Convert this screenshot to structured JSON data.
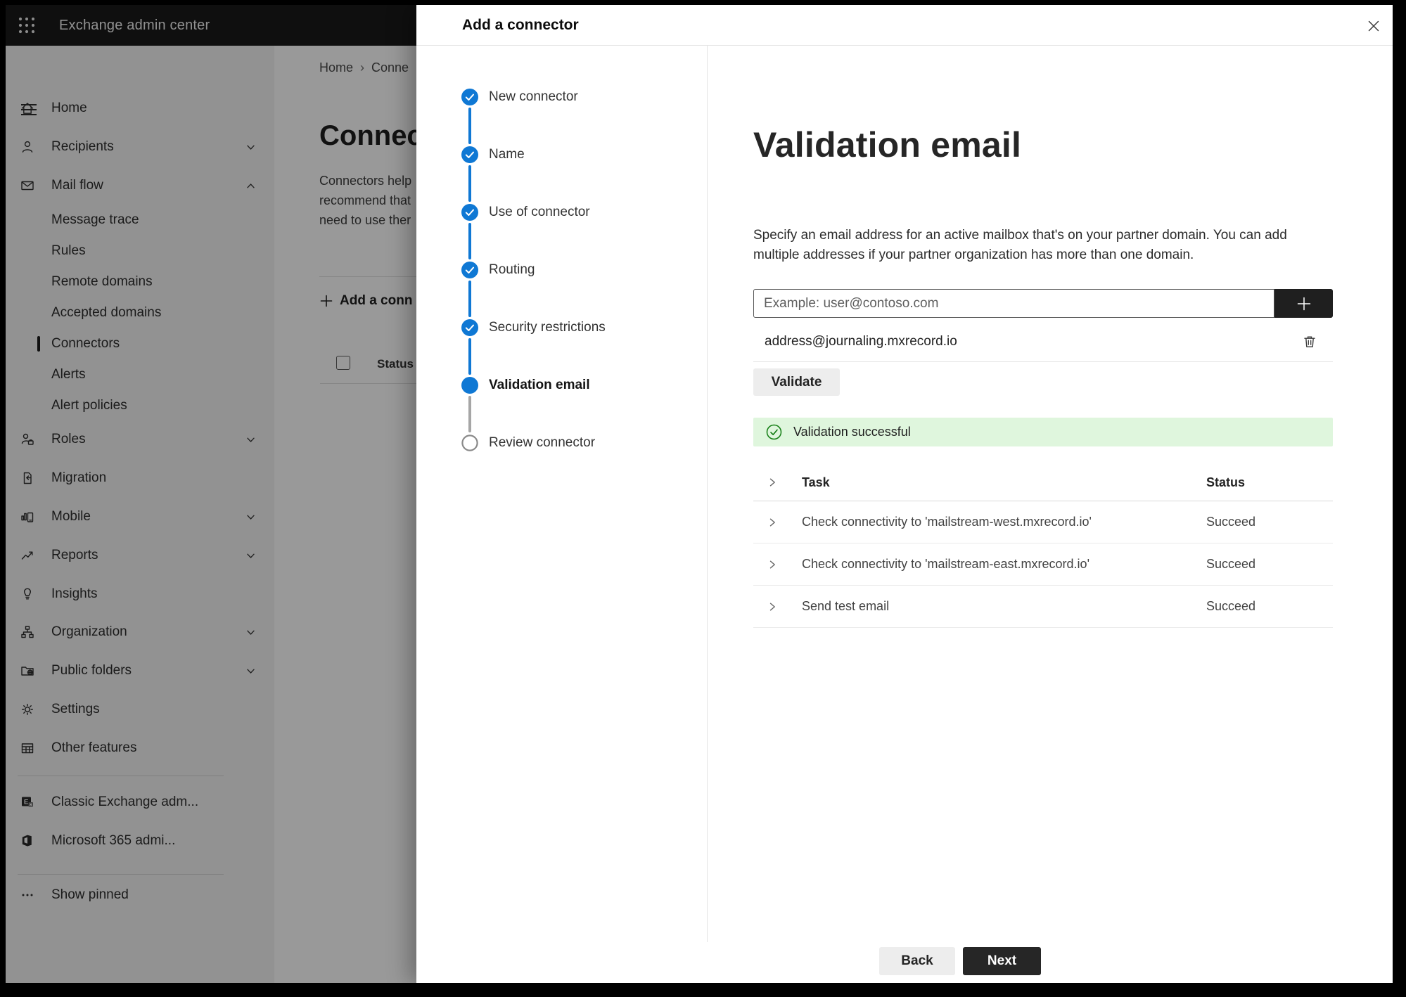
{
  "topbar": {
    "title": "Exchange admin center"
  },
  "sidebar": {
    "items": [
      {
        "type": "main",
        "label": "Home",
        "icon": "home-icon"
      },
      {
        "type": "main",
        "label": "Recipients",
        "icon": "person-icon",
        "chevron": "down"
      },
      {
        "type": "main",
        "label": "Mail flow",
        "icon": "mail-icon",
        "chevron": "up"
      },
      {
        "type": "sub",
        "label": "Message trace"
      },
      {
        "type": "sub",
        "label": "Rules"
      },
      {
        "type": "sub",
        "label": "Remote domains"
      },
      {
        "type": "sub",
        "label": "Accepted domains"
      },
      {
        "type": "sub",
        "label": "Connectors",
        "selected": true
      },
      {
        "type": "sub",
        "label": "Alerts"
      },
      {
        "type": "sub",
        "label": "Alert policies"
      },
      {
        "type": "main",
        "label": "Roles",
        "icon": "roles-icon",
        "chevron": "down"
      },
      {
        "type": "main",
        "label": "Migration",
        "icon": "migration-icon"
      },
      {
        "type": "main",
        "label": "Mobile",
        "icon": "mobile-icon",
        "chevron": "down"
      },
      {
        "type": "main",
        "label": "Reports",
        "icon": "reports-icon",
        "chevron": "down"
      },
      {
        "type": "main",
        "label": "Insights",
        "icon": "insights-icon"
      },
      {
        "type": "main",
        "label": "Organization",
        "icon": "organization-icon",
        "chevron": "down"
      },
      {
        "type": "main",
        "label": "Public folders",
        "icon": "public-folders-icon",
        "chevron": "down"
      },
      {
        "type": "main",
        "label": "Settings",
        "icon": "gear-icon"
      },
      {
        "type": "main",
        "label": "Other features",
        "icon": "table-icon"
      },
      {
        "type": "divider"
      },
      {
        "type": "main",
        "label": "Classic Exchange adm...",
        "icon": "exchange-logo-icon"
      },
      {
        "type": "main",
        "label": "Microsoft 365 admi...",
        "icon": "office-logo-icon"
      },
      {
        "type": "divider"
      },
      {
        "type": "main",
        "label": "Show pinned",
        "icon": "ellipsis-icon"
      }
    ]
  },
  "background_page": {
    "breadcrumb": {
      "home": "Home",
      "separator": "›",
      "current": "Conne"
    },
    "heading": "Connec",
    "paragraph_lines": [
      "Connectors help",
      "recommend that",
      "need to use ther"
    ],
    "add_button_label": "Add a conn",
    "status_header": "Status"
  },
  "modal": {
    "title": "Add a connector",
    "steps": [
      {
        "label": "New connector",
        "state": "complete"
      },
      {
        "label": "Name",
        "state": "complete"
      },
      {
        "label": "Use of connector",
        "state": "complete"
      },
      {
        "label": "Routing",
        "state": "complete"
      },
      {
        "label": "Security restrictions",
        "state": "complete"
      },
      {
        "label": "Validation email",
        "state": "current"
      },
      {
        "label": "Review connector",
        "state": "upcoming"
      }
    ],
    "content": {
      "heading": "Validation email",
      "description": "Specify an email address for an active mailbox that's on your partner domain. You can add multiple addresses if your partner organization has more than one domain.",
      "email_input": {
        "value": "",
        "placeholder": "Example: user@contoso.com"
      },
      "added_address": "address@journaling.mxrecord.io",
      "validate_label": "Validate",
      "banner_text": "Validation successful",
      "table": {
        "col_task": "Task",
        "col_status": "Status",
        "rows": [
          {
            "task": "Check connectivity to 'mailstream-west.mxrecord.io'",
            "status": "Succeed"
          },
          {
            "task": "Check connectivity to 'mailstream-east.mxrecord.io'",
            "status": "Succeed"
          },
          {
            "task": "Send test email",
            "status": "Succeed"
          }
        ]
      }
    },
    "footer": {
      "back": "Back",
      "next": "Next"
    }
  },
  "colors": {
    "accent_blue": "#0f78d4",
    "success_green": "#107c10",
    "banner_green_bg": "#dff6dd",
    "dark_button": "#262626"
  }
}
